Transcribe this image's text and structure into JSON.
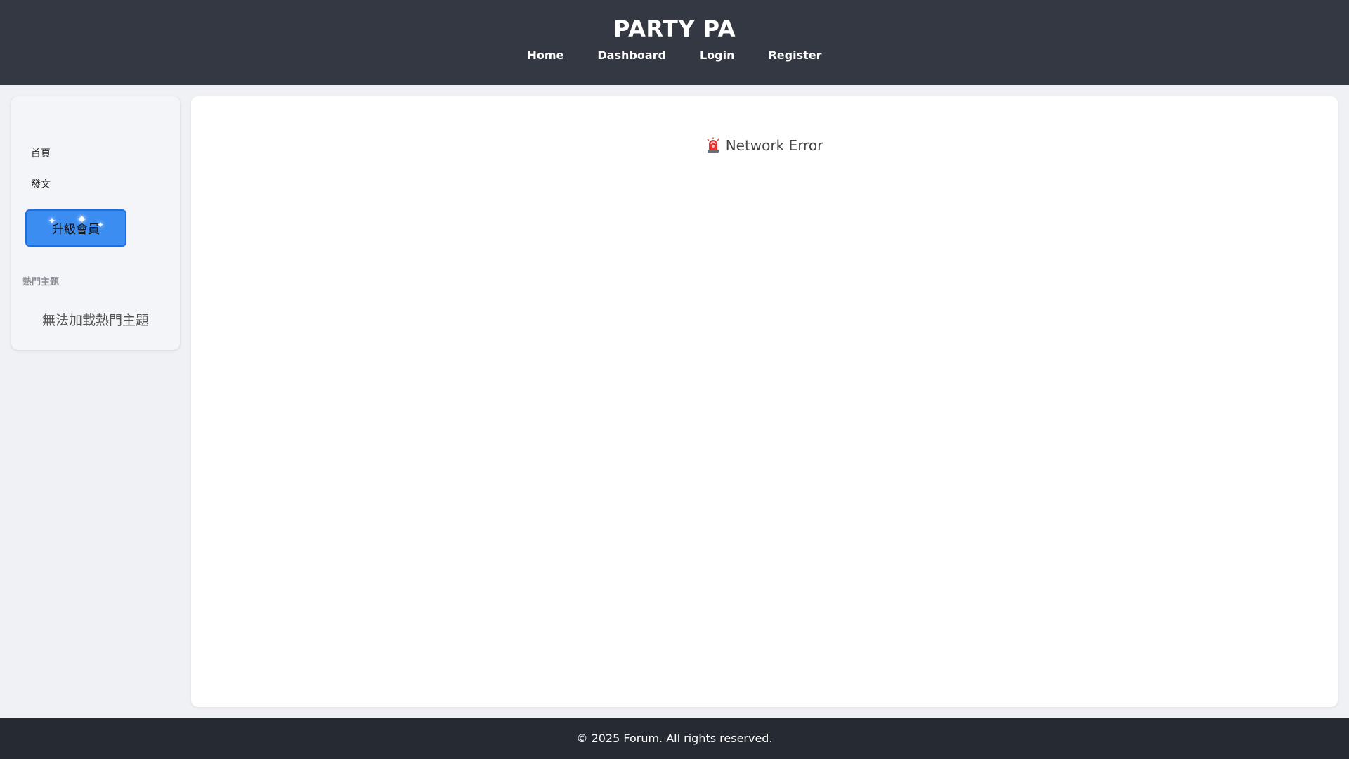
{
  "header": {
    "title": "PARTY PA",
    "nav": [
      {
        "label": "Home"
      },
      {
        "label": "Dashboard"
      },
      {
        "label": "Login"
      },
      {
        "label": "Register"
      }
    ]
  },
  "sidebar": {
    "items": [
      {
        "label": "首頁"
      },
      {
        "label": "發文"
      }
    ],
    "upgrade_label": "升級會員",
    "section_title": "熱門主題",
    "section_empty": "無法加載熱門主題"
  },
  "main": {
    "error_icon": "siren-icon",
    "error_text": "Network Error"
  },
  "footer": {
    "text": "© 2025 Forum. All rights reserved."
  },
  "colors": {
    "header_bg": "#343843",
    "footer_bg": "#262a33",
    "page_bg": "#f0f1f5",
    "upgrade_button": "#3b8df2"
  }
}
